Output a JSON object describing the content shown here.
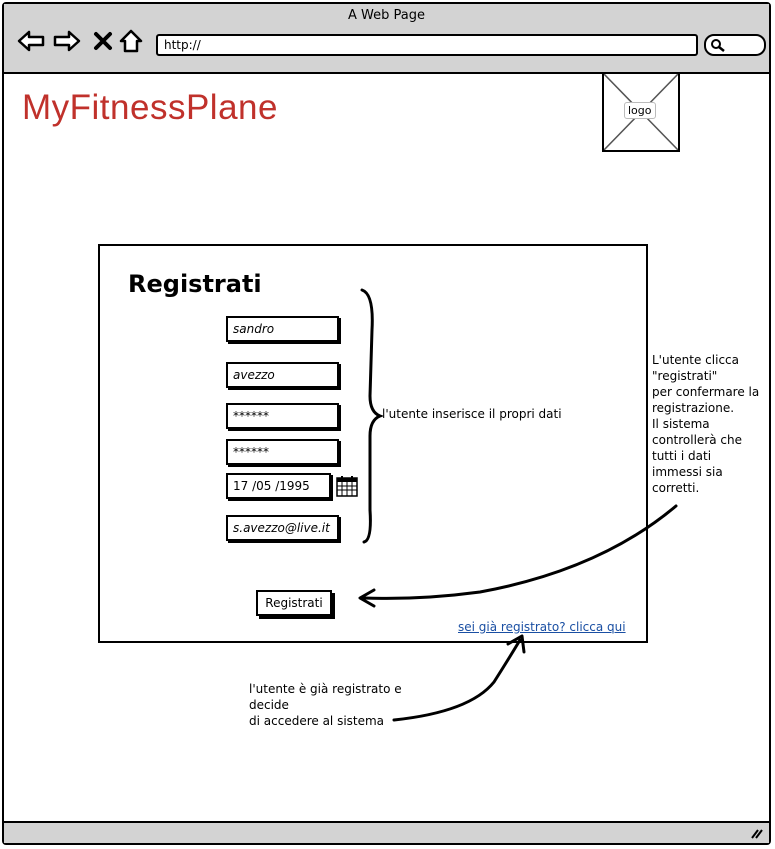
{
  "window": {
    "title": "A Web Page",
    "url": "http://"
  },
  "icons": {
    "back": "back-arrow-icon",
    "forward": "forward-arrow-icon",
    "stop": "close-icon",
    "home": "home-icon",
    "search": "search-icon",
    "calendar": "calendar-icon",
    "resize": "resize-grip-icon"
  },
  "header": {
    "brand": "MyFitnessPlane",
    "logo_label": "logo"
  },
  "form": {
    "title": "Registrati",
    "fields": {
      "first_name": "sandro",
      "last_name": "avezzo",
      "password": "******",
      "password_confirm": "******",
      "birth_date": "17 /05 /1995",
      "email": "s.avezzo@live.it"
    },
    "submit_label": "Registrati",
    "login_link": "sei già registrato? clicca qui"
  },
  "annotations": {
    "fields_note": "l'utente inserisce il propri dati",
    "submit_note": "L'utente clicca\n\"registrati\"\nper confermare la\nregistrazione.\nIl sistema\ncontrollerà che\ntutti i dati\nimmessi sia\ncorretti.",
    "login_note": "l'utente è già registrato e\ndecide\ndi accedere al sistema"
  }
}
